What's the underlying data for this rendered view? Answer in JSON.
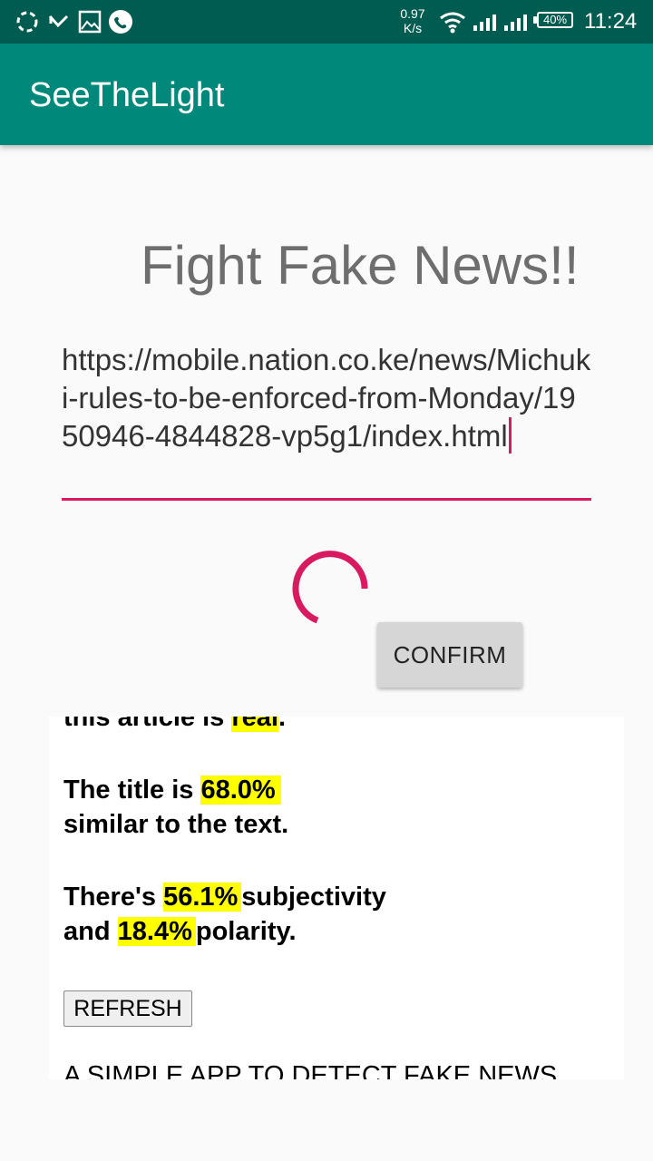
{
  "status_bar": {
    "net_speed_value": "0.97",
    "net_speed_unit": "K/s",
    "battery": "40%",
    "time": "11:24",
    "icons": [
      "sync-icon",
      "missed-call-icon",
      "image-icon",
      "whatsapp-icon",
      "wifi-icon",
      "signal-icon",
      "signal-icon",
      "battery-icon"
    ]
  },
  "app_bar": {
    "title": "SeeTheLight"
  },
  "main": {
    "headline": "Fight Fake News!!",
    "url_value": "https://mobile.nation.co.ke/news/Michuki-rules-to-be-enforced-from-Monday/1950946-4844828-vp5g1/index.html",
    "confirm_label": "CONFIRM"
  },
  "result": {
    "verdict_prefix": "this article is",
    "verdict_value": "real",
    "verdict_suffix": ".",
    "title_prefix": "The title is",
    "title_similarity": "68.0%",
    "title_suffix": "similar to the text.",
    "subjectivity_prefix": "There's",
    "subjectivity_value": "56.1%",
    "subjectivity_suffix": "subjectivity",
    "polarity_prefix": "and",
    "polarity_value": "18.4%",
    "polarity_suffix": "polarity.",
    "refresh_label": "REFRESH",
    "footer": "A SIMPLE APP TO DETECT FAKE NEWS"
  },
  "colors": {
    "status_bar": "#005c50",
    "app_bar": "#00897b",
    "accent": "#d81b60",
    "highlight": "#ffff00"
  }
}
